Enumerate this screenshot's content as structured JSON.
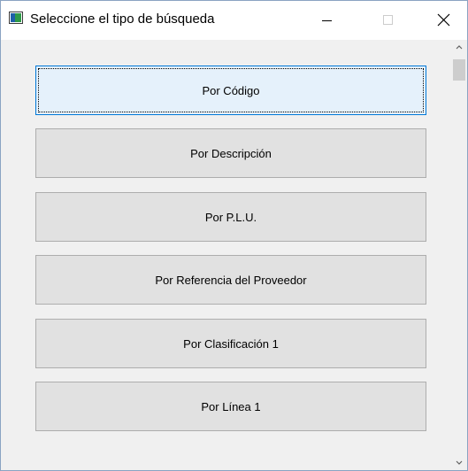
{
  "window": {
    "title": "Seleccione el tipo de búsqueda",
    "controls": {
      "minimize": "minimize",
      "maximize": "maximize",
      "close": "close"
    }
  },
  "options": [
    {
      "label": "Por Código",
      "focused": true
    },
    {
      "label": "Por Descripción",
      "focused": false
    },
    {
      "label": "Por P.L.U.",
      "focused": false
    },
    {
      "label": "Por Referencia del Proveedor",
      "focused": false
    },
    {
      "label": "Por Clasificación 1",
      "focused": false
    },
    {
      "label": "Por Línea 1",
      "focused": false
    }
  ],
  "colors": {
    "focus_border": "#0078d7",
    "focus_fill": "#e5f1fb",
    "button_fill": "#e1e1e1"
  }
}
